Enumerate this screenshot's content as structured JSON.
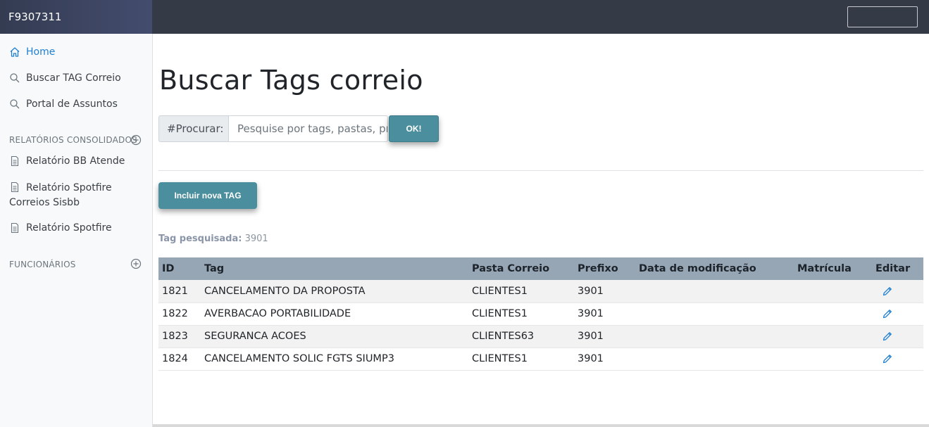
{
  "header": {
    "app_id": "F9307311"
  },
  "sidebar": {
    "items": [
      {
        "label": "Home",
        "icon": "home-icon"
      },
      {
        "label": "Buscar TAG Correio",
        "icon": "search-icon"
      },
      {
        "label": "Portal de Assuntos",
        "icon": "search-icon"
      }
    ],
    "sections": [
      {
        "title": "RELATÓRIOS CONSOLIDADOS",
        "items": [
          {
            "label": "Relatório BB Atende",
            "icon": "document-icon"
          },
          {
            "label": "Relatório Spotfire Correios Sisbb",
            "icon": "document-icon"
          },
          {
            "label": "Relatório Spotfire",
            "icon": "document-icon"
          }
        ]
      },
      {
        "title": "FUNCIONÁRIOS",
        "items": []
      }
    ]
  },
  "main": {
    "title": "Buscar Tags correio",
    "search": {
      "label": "#Procurar:",
      "placeholder": "Pesquise por tags, pastas, prefixos",
      "value": "",
      "ok_label": "OK!"
    },
    "add_button": "Incluir nova TAG",
    "tag_info": {
      "label": "Tag pesquisada:",
      "value": "3901"
    },
    "table": {
      "headers": [
        "ID",
        "Tag",
        "Pasta Correio",
        "Prefixo",
        "Data de modificação",
        "Matrícula",
        "Editar"
      ],
      "rows": [
        {
          "id": "1821",
          "tag": "CANCELAMENTO DA PROPOSTA",
          "pasta": "CLIENTES1",
          "prefixo": "3901",
          "data": "",
          "matricula": ""
        },
        {
          "id": "1822",
          "tag": "AVERBACAO PORTABILIDADE",
          "pasta": "CLIENTES1",
          "prefixo": "3901",
          "data": "",
          "matricula": ""
        },
        {
          "id": "1823",
          "tag": "SEGURANCA ACOES",
          "pasta": "CLIENTES63",
          "prefixo": "3901",
          "data": "",
          "matricula": ""
        },
        {
          "id": "1824",
          "tag": "CANCELAMENTO SOLIC FGTS SIUMP3",
          "pasta": "CLIENTES1",
          "prefixo": "3901",
          "data": "",
          "matricula": ""
        }
      ]
    }
  },
  "colors": {
    "topbar": "#343a46",
    "accent_button": "#4b8e9e",
    "table_header": "#97a6b4",
    "active_link": "#1f7fd1"
  }
}
